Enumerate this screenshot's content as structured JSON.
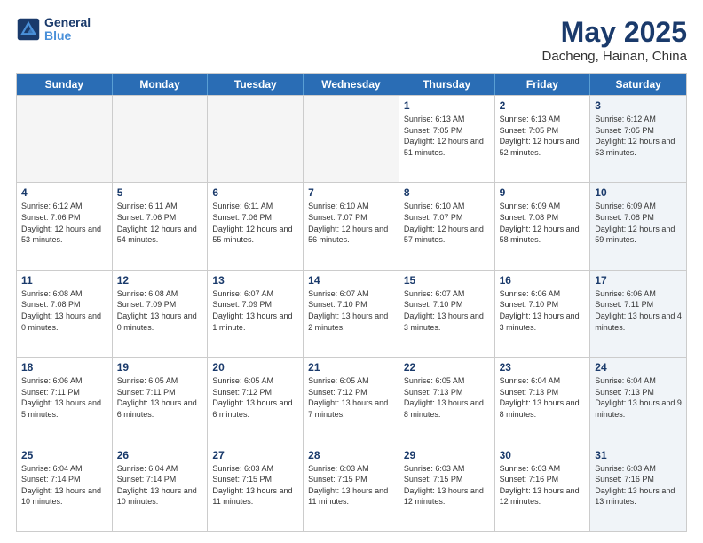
{
  "header": {
    "logo_line1": "General",
    "logo_line2": "Blue",
    "month": "May 2025",
    "location": "Dacheng, Hainan, China"
  },
  "weekdays": [
    "Sunday",
    "Monday",
    "Tuesday",
    "Wednesday",
    "Thursday",
    "Friday",
    "Saturday"
  ],
  "rows": [
    [
      {
        "day": "",
        "info": "",
        "empty": true
      },
      {
        "day": "",
        "info": "",
        "empty": true
      },
      {
        "day": "",
        "info": "",
        "empty": true
      },
      {
        "day": "",
        "info": "",
        "empty": true
      },
      {
        "day": "1",
        "info": "Sunrise: 6:13 AM\nSunset: 7:05 PM\nDaylight: 12 hours\nand 51 minutes.",
        "empty": false
      },
      {
        "day": "2",
        "info": "Sunrise: 6:13 AM\nSunset: 7:05 PM\nDaylight: 12 hours\nand 52 minutes.",
        "empty": false
      },
      {
        "day": "3",
        "info": "Sunrise: 6:12 AM\nSunset: 7:05 PM\nDaylight: 12 hours\nand 53 minutes.",
        "empty": false,
        "shaded": true
      }
    ],
    [
      {
        "day": "4",
        "info": "Sunrise: 6:12 AM\nSunset: 7:06 PM\nDaylight: 12 hours\nand 53 minutes.",
        "empty": false
      },
      {
        "day": "5",
        "info": "Sunrise: 6:11 AM\nSunset: 7:06 PM\nDaylight: 12 hours\nand 54 minutes.",
        "empty": false
      },
      {
        "day": "6",
        "info": "Sunrise: 6:11 AM\nSunset: 7:06 PM\nDaylight: 12 hours\nand 55 minutes.",
        "empty": false
      },
      {
        "day": "7",
        "info": "Sunrise: 6:10 AM\nSunset: 7:07 PM\nDaylight: 12 hours\nand 56 minutes.",
        "empty": false
      },
      {
        "day": "8",
        "info": "Sunrise: 6:10 AM\nSunset: 7:07 PM\nDaylight: 12 hours\nand 57 minutes.",
        "empty": false
      },
      {
        "day": "9",
        "info": "Sunrise: 6:09 AM\nSunset: 7:08 PM\nDaylight: 12 hours\nand 58 minutes.",
        "empty": false
      },
      {
        "day": "10",
        "info": "Sunrise: 6:09 AM\nSunset: 7:08 PM\nDaylight: 12 hours\nand 59 minutes.",
        "empty": false,
        "shaded": true
      }
    ],
    [
      {
        "day": "11",
        "info": "Sunrise: 6:08 AM\nSunset: 7:08 PM\nDaylight: 13 hours\nand 0 minutes.",
        "empty": false
      },
      {
        "day": "12",
        "info": "Sunrise: 6:08 AM\nSunset: 7:09 PM\nDaylight: 13 hours\nand 0 minutes.",
        "empty": false
      },
      {
        "day": "13",
        "info": "Sunrise: 6:07 AM\nSunset: 7:09 PM\nDaylight: 13 hours\nand 1 minute.",
        "empty": false
      },
      {
        "day": "14",
        "info": "Sunrise: 6:07 AM\nSunset: 7:10 PM\nDaylight: 13 hours\nand 2 minutes.",
        "empty": false
      },
      {
        "day": "15",
        "info": "Sunrise: 6:07 AM\nSunset: 7:10 PM\nDaylight: 13 hours\nand 3 minutes.",
        "empty": false
      },
      {
        "day": "16",
        "info": "Sunrise: 6:06 AM\nSunset: 7:10 PM\nDaylight: 13 hours\nand 3 minutes.",
        "empty": false
      },
      {
        "day": "17",
        "info": "Sunrise: 6:06 AM\nSunset: 7:11 PM\nDaylight: 13 hours\nand 4 minutes.",
        "empty": false,
        "shaded": true
      }
    ],
    [
      {
        "day": "18",
        "info": "Sunrise: 6:06 AM\nSunset: 7:11 PM\nDaylight: 13 hours\nand 5 minutes.",
        "empty": false
      },
      {
        "day": "19",
        "info": "Sunrise: 6:05 AM\nSunset: 7:11 PM\nDaylight: 13 hours\nand 6 minutes.",
        "empty": false
      },
      {
        "day": "20",
        "info": "Sunrise: 6:05 AM\nSunset: 7:12 PM\nDaylight: 13 hours\nand 6 minutes.",
        "empty": false
      },
      {
        "day": "21",
        "info": "Sunrise: 6:05 AM\nSunset: 7:12 PM\nDaylight: 13 hours\nand 7 minutes.",
        "empty": false
      },
      {
        "day": "22",
        "info": "Sunrise: 6:05 AM\nSunset: 7:13 PM\nDaylight: 13 hours\nand 8 minutes.",
        "empty": false
      },
      {
        "day": "23",
        "info": "Sunrise: 6:04 AM\nSunset: 7:13 PM\nDaylight: 13 hours\nand 8 minutes.",
        "empty": false
      },
      {
        "day": "24",
        "info": "Sunrise: 6:04 AM\nSunset: 7:13 PM\nDaylight: 13 hours\nand 9 minutes.",
        "empty": false,
        "shaded": true
      }
    ],
    [
      {
        "day": "25",
        "info": "Sunrise: 6:04 AM\nSunset: 7:14 PM\nDaylight: 13 hours\nand 10 minutes.",
        "empty": false
      },
      {
        "day": "26",
        "info": "Sunrise: 6:04 AM\nSunset: 7:14 PM\nDaylight: 13 hours\nand 10 minutes.",
        "empty": false
      },
      {
        "day": "27",
        "info": "Sunrise: 6:03 AM\nSunset: 7:15 PM\nDaylight: 13 hours\nand 11 minutes.",
        "empty": false
      },
      {
        "day": "28",
        "info": "Sunrise: 6:03 AM\nSunset: 7:15 PM\nDaylight: 13 hours\nand 11 minutes.",
        "empty": false
      },
      {
        "day": "29",
        "info": "Sunrise: 6:03 AM\nSunset: 7:15 PM\nDaylight: 13 hours\nand 12 minutes.",
        "empty": false
      },
      {
        "day": "30",
        "info": "Sunrise: 6:03 AM\nSunset: 7:16 PM\nDaylight: 13 hours\nand 12 minutes.",
        "empty": false
      },
      {
        "day": "31",
        "info": "Sunrise: 6:03 AM\nSunset: 7:16 PM\nDaylight: 13 hours\nand 13 minutes.",
        "empty": false,
        "shaded": true
      }
    ]
  ]
}
